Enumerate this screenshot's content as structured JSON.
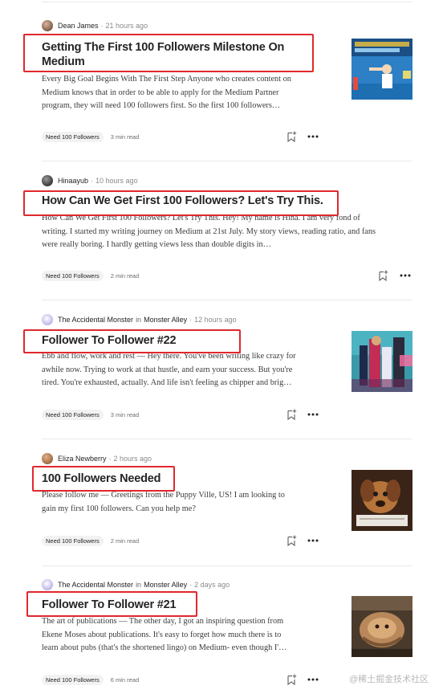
{
  "articles": [
    {
      "author": "Dean James",
      "time": "21 hours ago",
      "publication_prefix": "",
      "publication": "",
      "title_lines": [
        "Getting The First 100 Followers Milestone On",
        "Medium"
      ],
      "snippet_lines": [
        "Every Big Goal Begins With The First Step Anyone who creates content on",
        "Medium knows that in order to be able to apply for the Medium Partner",
        "program, they will need 100 followers first. So the first 100 followers…"
      ],
      "tag": "Need 100 Followers",
      "read_time": "3 min read",
      "avatar_color": "#8c6a55",
      "thumb_icon": "thumbnail-followers-poster"
    },
    {
      "author": "Hinaayub",
      "time": "10 hours ago",
      "publication_prefix": "",
      "publication": "",
      "title_lines": [
        "How Can We Get First 100 Followers? Let's Try This."
      ],
      "snippet_lines": [
        "How Can We Get First 100 Followers? Let's Try This. Hey! My name is Hina. I am very fond of",
        "writing. I started my writing journey on Medium at 21st July. My story views, reading ratio, and fans",
        "were really boring. I hardly getting views less than double digits in…"
      ],
      "tag": "Need 100 Followers",
      "read_time": "2 min read",
      "avatar_color": "#4a4a4a",
      "thumb_icon": ""
    },
    {
      "author": "The Accidental Monster",
      "time": "12 hours ago",
      "publication_prefix": "in",
      "publication": "Monster Alley",
      "title_lines": [
        "Follower To Follower #22"
      ],
      "snippet_lines": [
        "Ebb and flow, work and rest — Hey there. You've been writing like crazy for",
        "awhile now. Trying to work at that hustle, and earn your success. But you're",
        "tired. You're exhausted, actually. And life isn't feeling as chipper and brig…"
      ],
      "tag": "Need 100 Followers",
      "read_time": "3 min read",
      "avatar_color": "#b9b6e0",
      "thumb_icon": "thumbnail-colorful-figure"
    },
    {
      "author": "Eliza Newberry",
      "time": "2 hours ago",
      "publication_prefix": "",
      "publication": "",
      "title_lines": [
        "100 Followers Needed"
      ],
      "snippet_lines": [
        "Please follow me — Greetings from the Puppy Ville, US! I am looking to",
        "gain my first 100 followers. Can you help me?"
      ],
      "tag": "Need 100 Followers",
      "read_time": "2 min read",
      "avatar_color": "#b07a4f",
      "thumb_icon": "thumbnail-puppy"
    },
    {
      "author": "The Accidental Monster",
      "time": "2 days ago",
      "publication_prefix": "in",
      "publication": "Monster Alley",
      "title_lines": [
        "Follower To Follower #21"
      ],
      "snippet_lines": [
        "The art of publications — The other day, I got an inspiring question from",
        "Ekene Moses about publications. It's easy to forget how much there is to",
        "learn about pubs (that's the shortened lingo) on Medium- even though I'…"
      ],
      "tag": "Need 100 Followers",
      "read_time": "6 min read",
      "avatar_color": "#b9b6e0",
      "thumb_icon": "thumbnail-brown-creature"
    }
  ],
  "watermark": "@稀土掘金技术社区",
  "colors": {
    "highlight_box": "#e0282d",
    "tag_bg": "#f2f2f2",
    "text": "#242424",
    "muted": "#6b6b6b"
  },
  "icons": {
    "save": "bookmark-plus-icon",
    "more": "more-dots-icon"
  }
}
